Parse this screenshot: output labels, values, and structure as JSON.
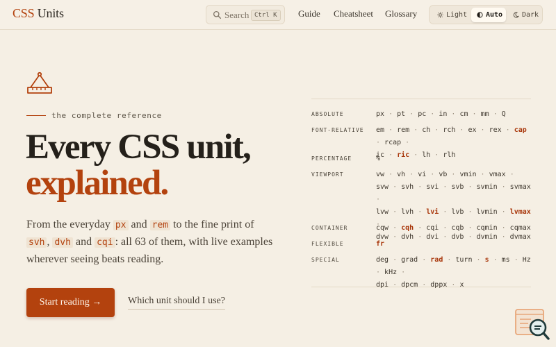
{
  "header": {
    "logo_accent": "CSS",
    "logo_rest": "Units",
    "search_label": "Search",
    "search_shortcut": "Ctrl K",
    "nav": [
      "Guide",
      "Cheatsheet",
      "Glossary"
    ],
    "theme": [
      {
        "label": "Light",
        "icon": "sun-icon",
        "active": false
      },
      {
        "label": "Auto",
        "icon": "half-circle-icon",
        "active": true
      },
      {
        "label": "Dark",
        "icon": "moon-icon",
        "active": false
      }
    ]
  },
  "hero": {
    "kicker": "the complete reference",
    "title_line1": "Every CSS unit,",
    "title_line2": "explained.",
    "lead": {
      "t1": "From the everyday ",
      "c1": "px",
      "t2": " and ",
      "c2": "rem",
      "t3": " to the fine print of ",
      "c3": "svh",
      "t4": ", ",
      "c4": "dvh",
      "t5": " and ",
      "c5": "cqi",
      "t6": ": all 63 of them, with live examples wherever seeing beats reading."
    },
    "cta_label": "Start reading →",
    "secondary_label": "Which unit should I use?"
  },
  "units_table": {
    "categories": [
      {
        "name": "ABSOLUTE",
        "lines": [
          [
            "px",
            "pt",
            "pc",
            "in",
            "cm",
            "mm",
            "Q"
          ]
        ],
        "highlights": []
      },
      {
        "name": "FONT-RELATIVE",
        "lines": [
          [
            "em",
            "rem",
            "ch",
            "rch",
            "ex",
            "rex",
            "cap",
            "rcap"
          ],
          [
            "ic",
            "ric",
            "lh",
            "rlh"
          ]
        ],
        "highlights": [
          "cap",
          "ric"
        ]
      },
      {
        "name": "PERCENTAGE",
        "lines": [
          [
            "%"
          ]
        ],
        "highlights": []
      },
      {
        "name": "VIEWPORT",
        "lines": [
          [
            "vw",
            "vh",
            "vi",
            "vb",
            "vmin",
            "vmax"
          ],
          [
            "svw",
            "svh",
            "svi",
            "svb",
            "svmin",
            "svmax"
          ],
          [
            "lvw",
            "lvh",
            "lvi",
            "lvb",
            "lvmin",
            "lvmax"
          ],
          [
            "dvw",
            "dvh",
            "dvi",
            "dvb",
            "dvmin",
            "dvmax"
          ]
        ],
        "highlights": [
          "lvi",
          "lvmax"
        ]
      },
      {
        "name": "CONTAINER",
        "lines": [
          [
            "cqw",
            "cqh",
            "cqi",
            "cqb",
            "cqmin",
            "cqmax"
          ]
        ],
        "highlights": [
          "cqh"
        ]
      },
      {
        "name": "FLEXIBLE",
        "lines": [
          [
            "fr"
          ]
        ],
        "highlights": [
          "fr"
        ]
      },
      {
        "name": "SPECIAL",
        "lines": [
          [
            "deg",
            "grad",
            "rad",
            "turn",
            "s",
            "ms",
            "Hz",
            "kHz"
          ],
          [
            "dpi",
            "dpcm",
            "dppx",
            "x"
          ]
        ],
        "highlights": [
          "rad",
          "s"
        ]
      }
    ]
  },
  "colors": {
    "accent": "#b3420e",
    "background": "#f5efe4",
    "text": "#24201a"
  }
}
